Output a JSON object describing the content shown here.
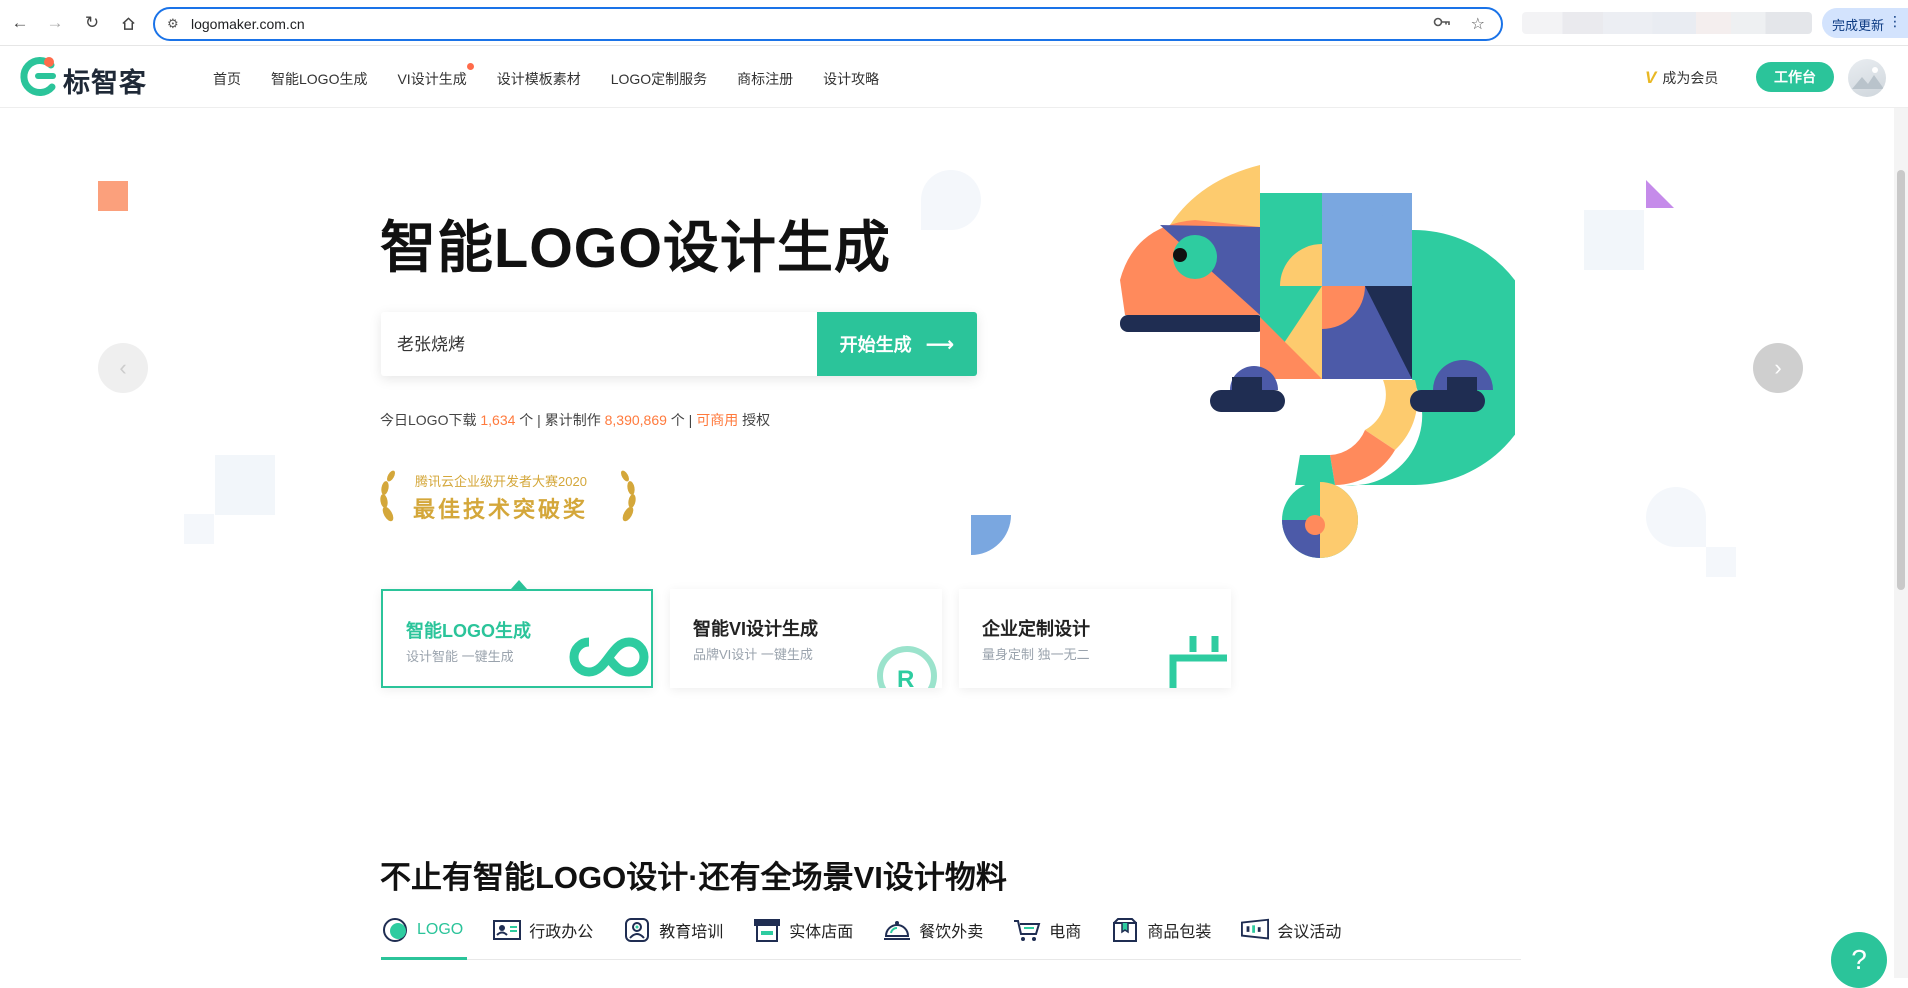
{
  "browser": {
    "url": "logomaker.com.cn",
    "update_label": "完成更新"
  },
  "header": {
    "brand": "标智客",
    "menu": [
      {
        "label": "首页"
      },
      {
        "label": "智能LOGO生成"
      },
      {
        "label": "VI设计生成"
      },
      {
        "label": "设计模板素材"
      },
      {
        "label": "LOGO定制服务"
      },
      {
        "label": "商标注册"
      },
      {
        "label": "设计攻略"
      }
    ],
    "vip_label": "成为会员",
    "workbench_label": "工作台"
  },
  "hero": {
    "title": "智能LOGO设计生成",
    "search_value": "老张烧烤",
    "generate_label": "开始生成",
    "stats": {
      "prefix": "今日LOGO下载",
      "today_count": "1,634",
      "unit1": "个 | 累计制作",
      "total_count": "8,390,869",
      "unit2": "个 |",
      "commercial": "可商用",
      "suffix": "授权"
    },
    "award": {
      "line1": "腾讯云企业级开发者大赛2020",
      "line2": "最佳技术突破奖"
    }
  },
  "cards": [
    {
      "title": "智能LOGO生成",
      "subtitle": "设计智能 一键生成"
    },
    {
      "title": "智能VI设计生成",
      "subtitle": "品牌VI设计 一键生成"
    },
    {
      "title": "企业定制设计",
      "subtitle": "量身定制 独一无二"
    }
  ],
  "section": {
    "title": "不止有智能LOGO设计·还有全场景VI设计物料",
    "tabs": [
      {
        "label": "LOGO",
        "icon": "logo-icon"
      },
      {
        "label": "行政办公",
        "icon": "id-card-icon"
      },
      {
        "label": "教育培训",
        "icon": "teacher-icon"
      },
      {
        "label": "实体店面",
        "icon": "storefront-icon"
      },
      {
        "label": "餐饮外卖",
        "icon": "food-cloche-icon"
      },
      {
        "label": "电商",
        "icon": "cart-icon"
      },
      {
        "label": "商品包装",
        "icon": "package-icon"
      },
      {
        "label": "会议活动",
        "icon": "banner-icon"
      }
    ]
  },
  "help_label": "?",
  "colors": {
    "brand": "#2bc49a",
    "accent": "#ff7a3d",
    "gold": "#d4a73a"
  }
}
